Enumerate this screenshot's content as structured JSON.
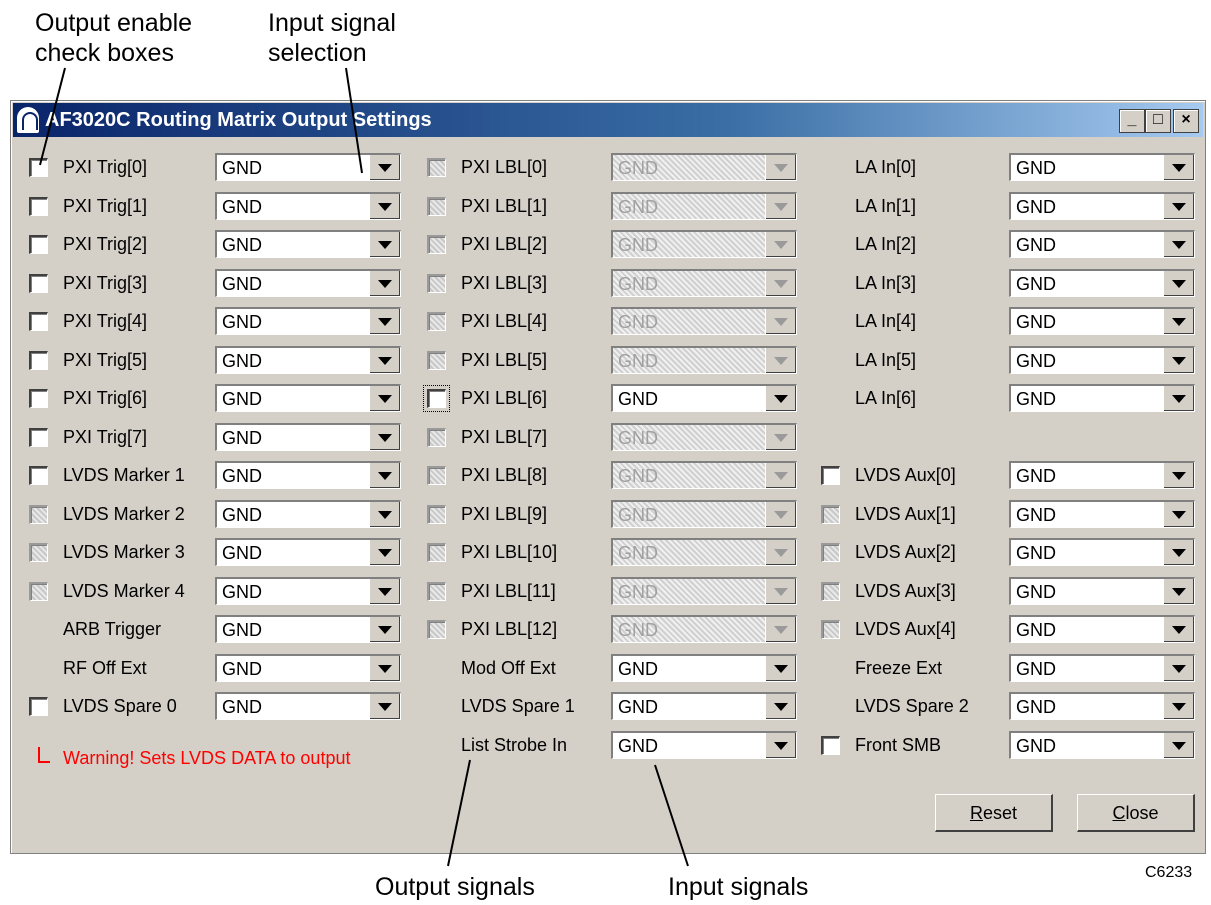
{
  "annotations": {
    "output_enable": [
      "Output enable",
      "check boxes"
    ],
    "input_selection": [
      "Input signal",
      "selection"
    ],
    "output_signals": "Output signals",
    "input_signals": "Input signals",
    "figure_code": "C6233"
  },
  "window": {
    "title": "AF3020C Routing Matrix Output Settings",
    "controls": {
      "minimize": "_",
      "maximize": "□",
      "close": "×"
    }
  },
  "columns": [
    {
      "rows": [
        {
          "label": "PXI Trig[0]",
          "checkbox": "enabled",
          "value": "GND",
          "combo": "enabled"
        },
        {
          "label": "PXI Trig[1]",
          "checkbox": "enabled",
          "value": "GND",
          "combo": "enabled"
        },
        {
          "label": "PXI Trig[2]",
          "checkbox": "enabled",
          "value": "GND",
          "combo": "enabled"
        },
        {
          "label": "PXI Trig[3]",
          "checkbox": "enabled",
          "value": "GND",
          "combo": "enabled"
        },
        {
          "label": "PXI Trig[4]",
          "checkbox": "enabled",
          "value": "GND",
          "combo": "enabled"
        },
        {
          "label": "PXI Trig[5]",
          "checkbox": "enabled",
          "value": "GND",
          "combo": "enabled"
        },
        {
          "label": "PXI Trig[6]",
          "checkbox": "enabled",
          "value": "GND",
          "combo": "enabled"
        },
        {
          "label": "PXI Trig[7]",
          "checkbox": "enabled",
          "value": "GND",
          "combo": "enabled"
        },
        {
          "label": "LVDS Marker 1",
          "checkbox": "enabled",
          "value": "GND",
          "combo": "enabled"
        },
        {
          "label": "LVDS Marker 2",
          "checkbox": "disabled",
          "value": "GND",
          "combo": "enabled"
        },
        {
          "label": "LVDS Marker 3",
          "checkbox": "disabled",
          "value": "GND",
          "combo": "enabled"
        },
        {
          "label": "LVDS Marker 4",
          "checkbox": "disabled",
          "value": "GND",
          "combo": "enabled"
        },
        {
          "label": "ARB Trigger",
          "checkbox": "none",
          "value": "GND",
          "combo": "enabled"
        },
        {
          "label": "RF Off Ext",
          "checkbox": "none",
          "value": "GND",
          "combo": "enabled"
        },
        {
          "label": "LVDS Spare 0",
          "checkbox": "enabled",
          "value": "GND",
          "combo": "enabled"
        }
      ]
    },
    {
      "rows": [
        {
          "label": "PXI LBL[0]",
          "checkbox": "disabled",
          "value": "GND",
          "combo": "disabled"
        },
        {
          "label": "PXI LBL[1]",
          "checkbox": "disabled",
          "value": "GND",
          "combo": "disabled"
        },
        {
          "label": "PXI LBL[2]",
          "checkbox": "disabled",
          "value": "GND",
          "combo": "disabled"
        },
        {
          "label": "PXI LBL[3]",
          "checkbox": "disabled",
          "value": "GND",
          "combo": "disabled"
        },
        {
          "label": "PXI LBL[4]",
          "checkbox": "disabled",
          "value": "GND",
          "combo": "disabled"
        },
        {
          "label": "PXI LBL[5]",
          "checkbox": "disabled",
          "value": "GND",
          "combo": "disabled"
        },
        {
          "label": "PXI LBL[6]",
          "checkbox": "focused",
          "value": "GND",
          "combo": "enabled"
        },
        {
          "label": "PXI LBL[7]",
          "checkbox": "disabled",
          "value": "GND",
          "combo": "disabled"
        },
        {
          "label": "PXI LBL[8]",
          "checkbox": "disabled",
          "value": "GND",
          "combo": "disabled"
        },
        {
          "label": "PXI LBL[9]",
          "checkbox": "disabled",
          "value": "GND",
          "combo": "disabled"
        },
        {
          "label": "PXI LBL[10]",
          "checkbox": "disabled",
          "value": "GND",
          "combo": "disabled"
        },
        {
          "label": "PXI LBL[11]",
          "checkbox": "disabled",
          "value": "GND",
          "combo": "disabled"
        },
        {
          "label": "PXI LBL[12]",
          "checkbox": "disabled",
          "value": "GND",
          "combo": "disabled"
        },
        {
          "label": "Mod Off Ext",
          "checkbox": "none",
          "value": "GND",
          "combo": "enabled"
        },
        {
          "label": "LVDS Spare 1",
          "checkbox": "none",
          "value": "GND",
          "combo": "enabled"
        },
        {
          "label": "List Strobe In",
          "checkbox": "none",
          "value": "GND",
          "combo": "enabled"
        }
      ]
    },
    {
      "rows": [
        {
          "label": "LA In[0]",
          "checkbox": "none",
          "value": "GND",
          "combo": "enabled"
        },
        {
          "label": "LA In[1]",
          "checkbox": "none",
          "value": "GND",
          "combo": "enabled"
        },
        {
          "label": "LA In[2]",
          "checkbox": "none",
          "value": "GND",
          "combo": "enabled"
        },
        {
          "label": "LA In[3]",
          "checkbox": "none",
          "value": "GND",
          "combo": "enabled"
        },
        {
          "label": "LA In[4]",
          "checkbox": "none",
          "value": "GND",
          "combo": "enabled"
        },
        {
          "label": "LA In[5]",
          "checkbox": "none",
          "value": "GND",
          "combo": "enabled"
        },
        {
          "label": "LA In[6]",
          "checkbox": "none",
          "value": "GND",
          "combo": "enabled"
        },
        null,
        {
          "label": "LVDS Aux[0]",
          "checkbox": "enabled",
          "value": "GND",
          "combo": "enabled"
        },
        {
          "label": "LVDS Aux[1]",
          "checkbox": "disabled",
          "value": "GND",
          "combo": "enabled"
        },
        {
          "label": "LVDS Aux[2]",
          "checkbox": "disabled",
          "value": "GND",
          "combo": "enabled"
        },
        {
          "label": "LVDS Aux[3]",
          "checkbox": "disabled",
          "value": "GND",
          "combo": "enabled"
        },
        {
          "label": "LVDS Aux[4]",
          "checkbox": "disabled",
          "value": "GND",
          "combo": "enabled"
        },
        {
          "label": "Freeze Ext",
          "checkbox": "none",
          "value": "GND",
          "combo": "enabled"
        },
        {
          "label": "LVDS Spare 2",
          "checkbox": "none",
          "value": "GND",
          "combo": "enabled"
        },
        {
          "label": "Front SMB",
          "checkbox": "enabled",
          "value": "GND",
          "combo": "enabled"
        }
      ]
    }
  ],
  "warning": "Warning! Sets LVDS DATA to output",
  "buttons": {
    "reset": {
      "mnemonic": "R",
      "rest": "eset"
    },
    "close": {
      "mnemonic": "C",
      "rest": "lose"
    }
  }
}
